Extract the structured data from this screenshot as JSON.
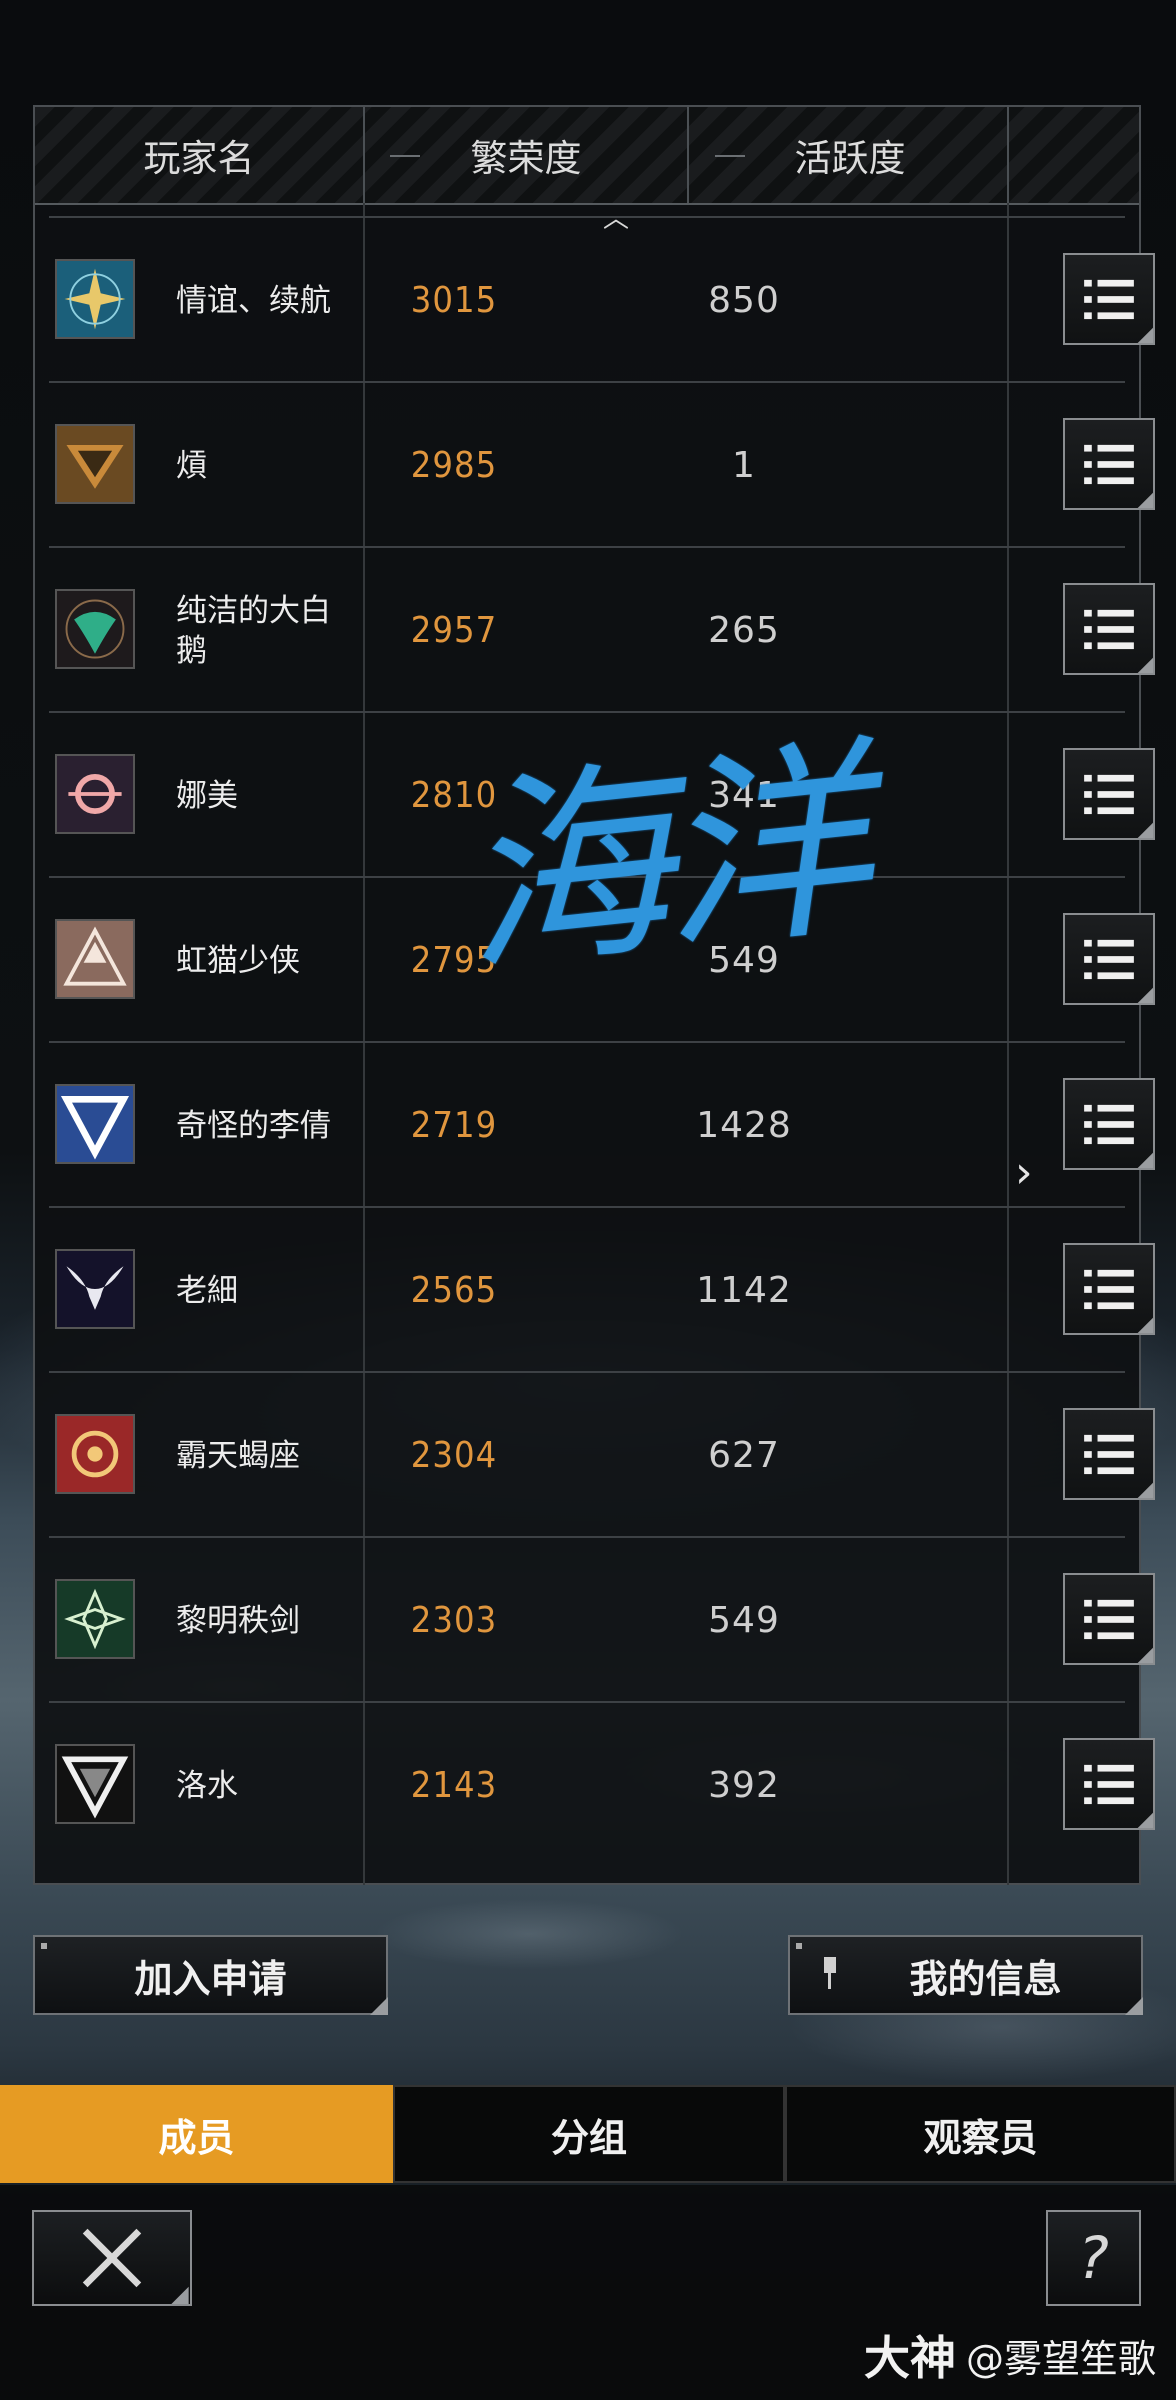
{
  "header": {
    "col_player": "玩家名",
    "col_prosperity": "繁荣度",
    "col_activity": "活跃度"
  },
  "colors": {
    "accent": "#e69b23",
    "prosperity_text": "#e0963e",
    "watermark": "#2f95dc"
  },
  "members": [
    {
      "name": "情谊、续航",
      "prosperity": "3015",
      "activity": "850",
      "avatar_icon": "star-compass-emblem-icon"
    },
    {
      "name": "熕",
      "prosperity": "2985",
      "activity": "1",
      "avatar_icon": "bronze-chevron-emblem-icon"
    },
    {
      "name": "纯洁的大白鹅",
      "prosperity": "2957",
      "activity": "265",
      "avatar_icon": "green-mask-emblem-icon"
    },
    {
      "name": "娜美",
      "prosperity": "2810",
      "activity": "341",
      "avatar_icon": "pink-ring-emblem-icon"
    },
    {
      "name": "虹猫少侠",
      "prosperity": "2795",
      "activity": "549",
      "avatar_icon": "triangle-crest-emblem-icon"
    },
    {
      "name": "奇怪的李倩",
      "prosperity": "2719",
      "activity": "1428",
      "avatar_icon": "blue-v-emblem-icon"
    },
    {
      "name": "老細",
      "prosperity": "2565",
      "activity": "1142",
      "avatar_icon": "horned-skull-emblem-icon"
    },
    {
      "name": "霸天蝎座",
      "prosperity": "2304",
      "activity": "627",
      "avatar_icon": "red-target-emblem-icon"
    },
    {
      "name": "黎明秩剑",
      "prosperity": "2303",
      "activity": "549",
      "avatar_icon": "green-diamond-emblem-icon"
    },
    {
      "name": "洛水",
      "prosperity": "2143",
      "activity": "392",
      "avatar_icon": "triangle-2-emblem-icon"
    }
  ],
  "watermark_text": "海洋",
  "buttons": {
    "join_requests": "加入申请",
    "my_info": "我的信息"
  },
  "tabs": [
    {
      "label": "成员",
      "active": true
    },
    {
      "label": "分组",
      "active": false
    },
    {
      "label": "观察员",
      "active": false
    }
  ],
  "credit": {
    "brand": "大神",
    "handle": "@雾望笙歌"
  }
}
